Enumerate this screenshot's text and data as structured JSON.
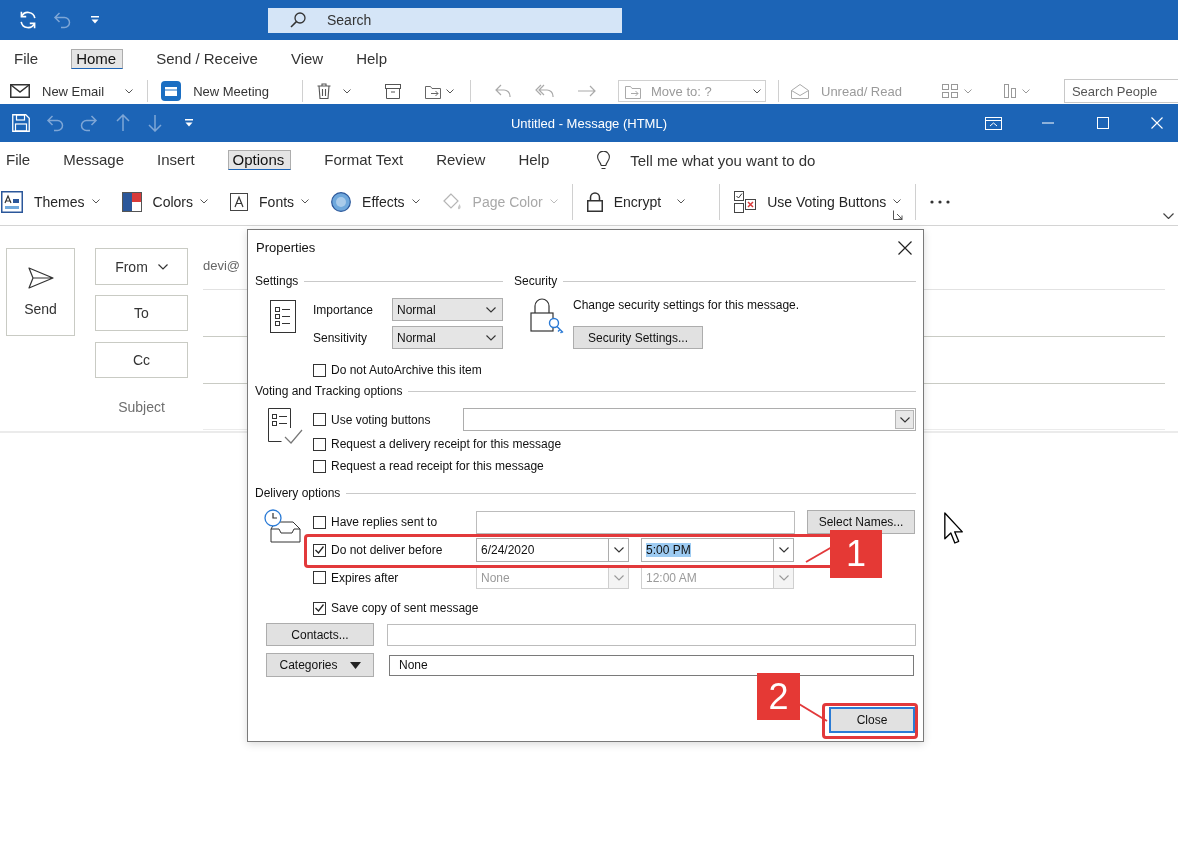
{
  "main_window": {
    "search": {
      "placeholder": "Search"
    },
    "tabs": [
      {
        "label": "File",
        "selected": false
      },
      {
        "label": "Home",
        "selected": true
      },
      {
        "label": "Send / Receive",
        "selected": false
      },
      {
        "label": "View",
        "selected": false
      },
      {
        "label": "Help",
        "selected": false
      }
    ],
    "ribbon": {
      "new_email": {
        "label": "New Email",
        "disabled": false
      },
      "new_meeting": {
        "label": "New Meeting",
        "disabled": false
      },
      "move_to": {
        "label": "Move to: ?",
        "disabled": true
      },
      "unread_read": {
        "label": "Unread/ Read",
        "disabled": true
      },
      "search_people": {
        "placeholder": "Search People"
      }
    }
  },
  "message_window": {
    "title": "Untitled - Message (HTML)",
    "tabs": [
      {
        "label": "File",
        "selected": false
      },
      {
        "label": "Message",
        "selected": false
      },
      {
        "label": "Insert",
        "selected": false
      },
      {
        "label": "Options",
        "selected": true
      },
      {
        "label": "Format Text",
        "selected": false
      },
      {
        "label": "Review",
        "selected": false
      },
      {
        "label": "Help",
        "selected": false
      }
    ],
    "tell_me": {
      "placeholder": "Tell me what you want to do"
    },
    "ribbon_groups": [
      {
        "items": [
          {
            "label": "Themes",
            "disabled": false
          },
          {
            "label": "Colors",
            "disabled": false
          },
          {
            "label": "Fonts",
            "disabled": false
          },
          {
            "label": "Effects",
            "disabled": false
          },
          {
            "label": "Page Color",
            "disabled": true
          }
        ]
      },
      {
        "items": [
          {
            "label": "Encrypt",
            "disabled": false
          }
        ]
      },
      {
        "items": [
          {
            "label": "Use Voting Buttons",
            "disabled": false
          }
        ]
      }
    ]
  },
  "compose": {
    "send_button": "Send",
    "from_button": "From",
    "from_value": "devi@",
    "to_button": "To",
    "cc_button": "Cc",
    "subject_label": "Subject"
  },
  "dialog": {
    "title": "Properties",
    "settings": {
      "heading": "Settings",
      "importance": {
        "label": "Importance",
        "value": "Normal"
      },
      "sensitivity": {
        "label": "Sensitivity",
        "value": "Normal"
      },
      "auto_archive": {
        "label": "Do not AutoArchive this item",
        "checked": false
      }
    },
    "security": {
      "heading": "Security",
      "description": "Change security settings for this message.",
      "button": "Security Settings..."
    },
    "voting_tracking": {
      "heading": "Voting and Tracking options",
      "options": [
        {
          "label": "Use voting buttons",
          "checked": false
        },
        {
          "label": "Request a delivery receipt for this message",
          "checked": false
        },
        {
          "label": "Request a read receipt for this message",
          "checked": false
        }
      ]
    },
    "delivery": {
      "heading": "Delivery options",
      "replies": {
        "label": "Have replies sent to",
        "checked": false,
        "button": "Select Names..."
      },
      "deliver_before": {
        "label": "Do not deliver before",
        "checked": true,
        "date": "6/24/2020",
        "time": "5:00 PM",
        "disabled": false,
        "time_selected": true
      },
      "expires": {
        "label": "Expires after",
        "checked": false,
        "date": "None",
        "time": "12:00 AM",
        "disabled": true,
        "time_selected": false
      },
      "save_copy": {
        "label": "Save copy of sent message",
        "checked": true
      }
    },
    "contacts": {
      "button": "Contacts..."
    },
    "categories": {
      "button": "Categories",
      "value": "None"
    },
    "close_button": {
      "label": "Close",
      "default": true
    }
  },
  "annotations": [
    {
      "label": "1"
    },
    {
      "label": "2"
    }
  ]
}
